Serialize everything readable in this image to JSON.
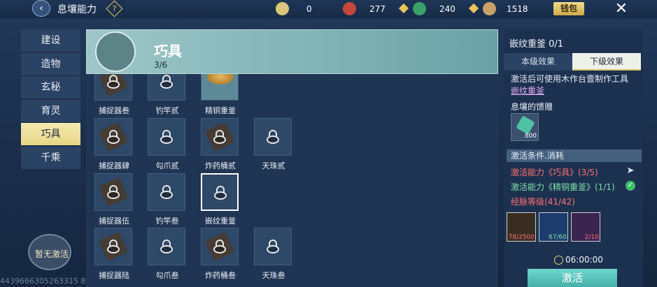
{
  "topbar": {
    "title": "息壤能力",
    "help_icon": "?",
    "resources": [
      {
        "name": "jade-coin-icon",
        "value": "0",
        "color": "#d9c87a"
      },
      {
        "name": "copper-coin-icon",
        "value": "277",
        "color": "#c4473b"
      },
      {
        "name": "jade-ring-icon",
        "value": "240",
        "color": "#3aa06a"
      },
      {
        "name": "seed-icon",
        "value": "1518",
        "color": "#c9a06a"
      }
    ],
    "wallet_label": "钱包",
    "close_icon": "✕"
  },
  "nav": {
    "items": [
      {
        "label": "建设"
      },
      {
        "label": "造物"
      },
      {
        "label": "玄秘"
      },
      {
        "label": "育灵"
      },
      {
        "label": "巧具",
        "active": true
      },
      {
        "label": "千乘"
      }
    ],
    "no_activate_label": "暂无激活"
  },
  "footer_id": "4439666305263315 8",
  "banner": {
    "title": "巧具",
    "count": "3/6"
  },
  "grid": {
    "rows": [
      [
        {
          "label": "捕捉器叁",
          "state": "locked"
        },
        {
          "label": "钓竿贰",
          "state": "locked"
        },
        {
          "label": "精铜重釜",
          "state": "unlocked"
        }
      ],
      [
        {
          "label": "捕捉器肆",
          "state": "locked"
        },
        {
          "label": "勾爪贰",
          "state": "locked"
        },
        {
          "label": "炸药桶贰",
          "state": "locked"
        },
        {
          "label": "天珠贰",
          "state": "locked"
        }
      ],
      [
        {
          "label": "捕捉器伍",
          "state": "locked"
        },
        {
          "label": "钓竿叁",
          "state": "locked"
        },
        {
          "label": "嵌纹重釜",
          "state": "selected"
        }
      ],
      [
        {
          "label": "捕捉器陆",
          "state": "locked"
        },
        {
          "label": "勾爪叁",
          "state": "locked"
        },
        {
          "label": "炸药桶叁",
          "state": "locked"
        },
        {
          "label": "天珠叁",
          "state": "locked"
        }
      ]
    ]
  },
  "detail": {
    "title": "嵌纹重釜 0/1",
    "tab_current": "本级效果",
    "tab_next": "下级效果",
    "desc": "激活后可使用木作台壹制作工具",
    "link": "嵌纹重釜",
    "gift_title": "息壤的馈赠",
    "gift_count": "800",
    "cond_head": "激活条件.消耗",
    "conditions": [
      {
        "text": "激活能力《巧具》(3/5)",
        "status": "red"
      },
      {
        "text": "激活能力《精铜重釜》(1/1)",
        "status": "green"
      },
      {
        "text": "经脉等级(41/42)",
        "status": "red"
      }
    ],
    "costs": [
      {
        "count": "78/2500",
        "color": "#c4473b"
      },
      {
        "count": "67/60",
        "color": "#7fe0a8"
      },
      {
        "count": "2/10",
        "color": "#ff6e6e"
      }
    ],
    "timer": "06:00:00",
    "activate_label": "激活"
  }
}
